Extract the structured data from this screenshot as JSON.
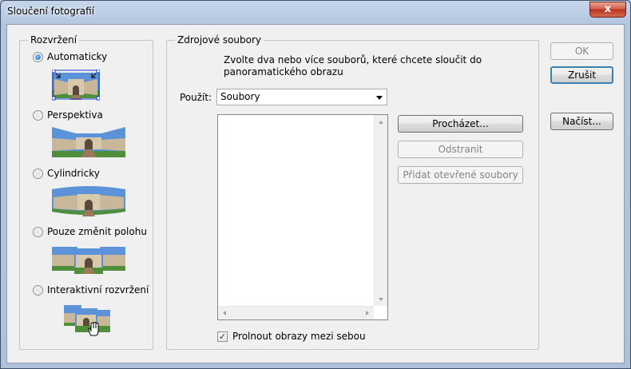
{
  "window": {
    "title": "Sloučení fotografií",
    "close_glyph": "x"
  },
  "layout_group": {
    "legend": "Rozvržení",
    "options": [
      {
        "label": "Automaticky",
        "selected": true
      },
      {
        "label": "Perspektiva",
        "selected": false
      },
      {
        "label": "Cylindricky",
        "selected": false
      },
      {
        "label": "Pouze změnit polohu",
        "selected": false
      },
      {
        "label": "Interaktivní rozvržení",
        "selected": false
      }
    ]
  },
  "source_group": {
    "legend": "Zdrojové soubory",
    "description_line1": "Zvolte dva nebo více souborů, které chcete sloučit do",
    "description_line2": "panoramatického obrazu",
    "use_label": "Použít:",
    "use_value": "Soubory",
    "browse_label": "Procházet...",
    "remove_label": "Odstranit",
    "add_open_label": "Přidat otevřené soubory",
    "blend_label": "Prolnout obrazy mezi sebou",
    "blend_checked": true
  },
  "actions": {
    "ok_label": "OK",
    "cancel_label": "Zrušit",
    "load_label": "Načíst..."
  },
  "colors": {
    "accent": "#3c7fb1",
    "sky": "#5b92d8",
    "grass": "#4f8f3c",
    "building": "#c9b79a"
  }
}
